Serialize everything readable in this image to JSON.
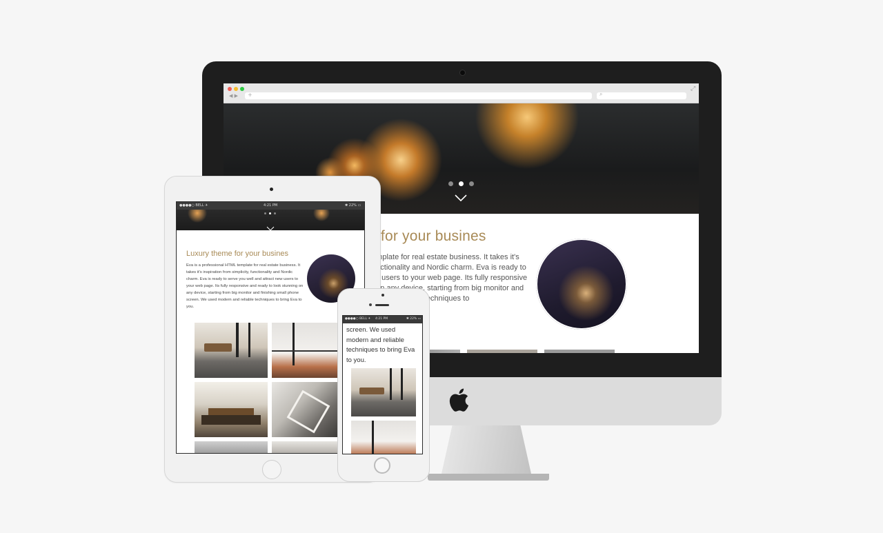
{
  "desktop": {
    "site_title": "e for your busines",
    "body_text": "template for real estate business. It takes it's functionality and Nordic charm. Eva is ready to ew users to your web page. Its fully responsive g on any device, starting from big monitor and ern and reliable techniques to",
    "slider_active_index": 1,
    "slider_count": 3
  },
  "tablet": {
    "status_left": "●●●●○ BELL ✈",
    "status_time": "4:21 PM",
    "status_right": "✱ 22% ▭",
    "title": "Luxury theme for your busines",
    "body_text": "Eva is a professional HTML template for real estate business. It takes it's inspiration from simplicity, functionality and Nordic charm. Eva is ready to serve you well and attract new users to your web page. Its fully responsive and ready to look stunning on any device, starting from big monitor and finishing small phone screen. We used modern and reliable techniques to bring Eva to you."
  },
  "phone": {
    "status_left": "●●●●○ BELL ✈",
    "status_time": "4:21 PM",
    "status_right": "✱ 22% ▭",
    "body_text": "screen. We used modern and reliable techniques to bring Eva to you."
  },
  "icons": {
    "apple_logo": "apple-logo-icon",
    "chevron": "chevron-down-icon"
  },
  "colors": {
    "accent": "#a88a56",
    "background": "#f6f6f6",
    "imac_frame": "#1e1e1e"
  }
}
